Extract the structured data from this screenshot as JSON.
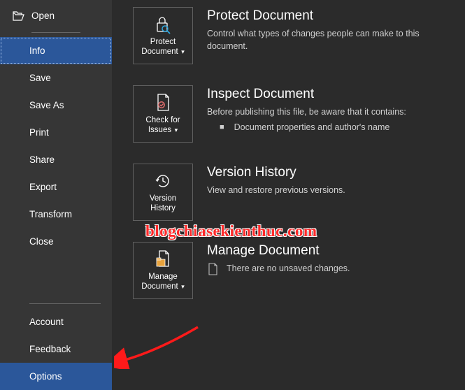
{
  "sidebar": {
    "open": "Open",
    "info": "Info",
    "save": "Save",
    "saveAs": "Save As",
    "print": "Print",
    "share": "Share",
    "export": "Export",
    "transform": "Transform",
    "close": "Close",
    "account": "Account",
    "feedback": "Feedback",
    "options": "Options"
  },
  "tiles": {
    "protect": "Protect Document",
    "check": "Check for Issues",
    "version": "Version History",
    "manage": "Manage Document"
  },
  "sections": {
    "protect": {
      "title": "Protect Document",
      "text": "Control what types of changes people can make to this document."
    },
    "inspect": {
      "title": "Inspect Document",
      "text": "Before publishing this file, be aware that it contains:",
      "bullet": "Document properties and author's name"
    },
    "version": {
      "title": "Version History",
      "text": "View and restore previous versions."
    },
    "manage": {
      "title": "Manage Document",
      "text": "There are no unsaved changes."
    }
  },
  "watermark": "blogchiasekienthuc.com"
}
